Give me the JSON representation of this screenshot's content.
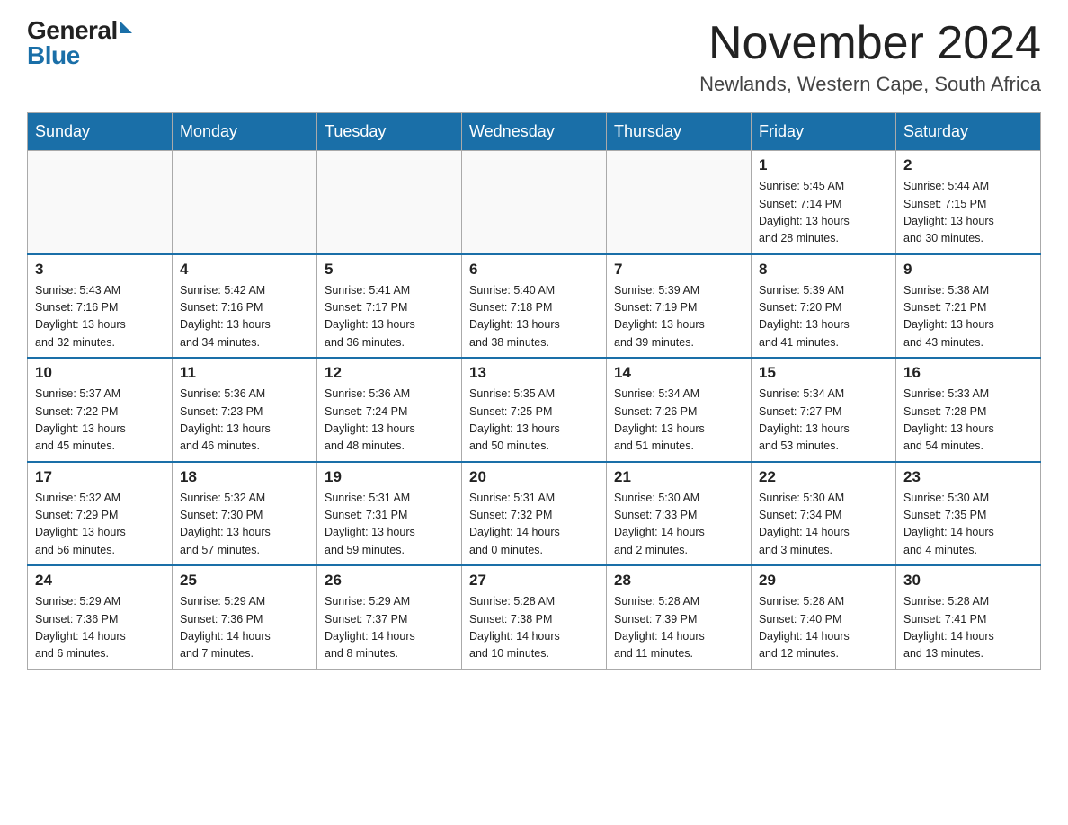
{
  "logo": {
    "general": "General",
    "blue": "Blue"
  },
  "title": "November 2024",
  "location": "Newlands, Western Cape, South Africa",
  "days_of_week": [
    "Sunday",
    "Monday",
    "Tuesday",
    "Wednesday",
    "Thursday",
    "Friday",
    "Saturday"
  ],
  "weeks": [
    [
      {
        "day": "",
        "info": ""
      },
      {
        "day": "",
        "info": ""
      },
      {
        "day": "",
        "info": ""
      },
      {
        "day": "",
        "info": ""
      },
      {
        "day": "",
        "info": ""
      },
      {
        "day": "1",
        "info": "Sunrise: 5:45 AM\nSunset: 7:14 PM\nDaylight: 13 hours\nand 28 minutes."
      },
      {
        "day": "2",
        "info": "Sunrise: 5:44 AM\nSunset: 7:15 PM\nDaylight: 13 hours\nand 30 minutes."
      }
    ],
    [
      {
        "day": "3",
        "info": "Sunrise: 5:43 AM\nSunset: 7:16 PM\nDaylight: 13 hours\nand 32 minutes."
      },
      {
        "day": "4",
        "info": "Sunrise: 5:42 AM\nSunset: 7:16 PM\nDaylight: 13 hours\nand 34 minutes."
      },
      {
        "day": "5",
        "info": "Sunrise: 5:41 AM\nSunset: 7:17 PM\nDaylight: 13 hours\nand 36 minutes."
      },
      {
        "day": "6",
        "info": "Sunrise: 5:40 AM\nSunset: 7:18 PM\nDaylight: 13 hours\nand 38 minutes."
      },
      {
        "day": "7",
        "info": "Sunrise: 5:39 AM\nSunset: 7:19 PM\nDaylight: 13 hours\nand 39 minutes."
      },
      {
        "day": "8",
        "info": "Sunrise: 5:39 AM\nSunset: 7:20 PM\nDaylight: 13 hours\nand 41 minutes."
      },
      {
        "day": "9",
        "info": "Sunrise: 5:38 AM\nSunset: 7:21 PM\nDaylight: 13 hours\nand 43 minutes."
      }
    ],
    [
      {
        "day": "10",
        "info": "Sunrise: 5:37 AM\nSunset: 7:22 PM\nDaylight: 13 hours\nand 45 minutes."
      },
      {
        "day": "11",
        "info": "Sunrise: 5:36 AM\nSunset: 7:23 PM\nDaylight: 13 hours\nand 46 minutes."
      },
      {
        "day": "12",
        "info": "Sunrise: 5:36 AM\nSunset: 7:24 PM\nDaylight: 13 hours\nand 48 minutes."
      },
      {
        "day": "13",
        "info": "Sunrise: 5:35 AM\nSunset: 7:25 PM\nDaylight: 13 hours\nand 50 minutes."
      },
      {
        "day": "14",
        "info": "Sunrise: 5:34 AM\nSunset: 7:26 PM\nDaylight: 13 hours\nand 51 minutes."
      },
      {
        "day": "15",
        "info": "Sunrise: 5:34 AM\nSunset: 7:27 PM\nDaylight: 13 hours\nand 53 minutes."
      },
      {
        "day": "16",
        "info": "Sunrise: 5:33 AM\nSunset: 7:28 PM\nDaylight: 13 hours\nand 54 minutes."
      }
    ],
    [
      {
        "day": "17",
        "info": "Sunrise: 5:32 AM\nSunset: 7:29 PM\nDaylight: 13 hours\nand 56 minutes."
      },
      {
        "day": "18",
        "info": "Sunrise: 5:32 AM\nSunset: 7:30 PM\nDaylight: 13 hours\nand 57 minutes."
      },
      {
        "day": "19",
        "info": "Sunrise: 5:31 AM\nSunset: 7:31 PM\nDaylight: 13 hours\nand 59 minutes."
      },
      {
        "day": "20",
        "info": "Sunrise: 5:31 AM\nSunset: 7:32 PM\nDaylight: 14 hours\nand 0 minutes."
      },
      {
        "day": "21",
        "info": "Sunrise: 5:30 AM\nSunset: 7:33 PM\nDaylight: 14 hours\nand 2 minutes."
      },
      {
        "day": "22",
        "info": "Sunrise: 5:30 AM\nSunset: 7:34 PM\nDaylight: 14 hours\nand 3 minutes."
      },
      {
        "day": "23",
        "info": "Sunrise: 5:30 AM\nSunset: 7:35 PM\nDaylight: 14 hours\nand 4 minutes."
      }
    ],
    [
      {
        "day": "24",
        "info": "Sunrise: 5:29 AM\nSunset: 7:36 PM\nDaylight: 14 hours\nand 6 minutes."
      },
      {
        "day": "25",
        "info": "Sunrise: 5:29 AM\nSunset: 7:36 PM\nDaylight: 14 hours\nand 7 minutes."
      },
      {
        "day": "26",
        "info": "Sunrise: 5:29 AM\nSunset: 7:37 PM\nDaylight: 14 hours\nand 8 minutes."
      },
      {
        "day": "27",
        "info": "Sunrise: 5:28 AM\nSunset: 7:38 PM\nDaylight: 14 hours\nand 10 minutes."
      },
      {
        "day": "28",
        "info": "Sunrise: 5:28 AM\nSunset: 7:39 PM\nDaylight: 14 hours\nand 11 minutes."
      },
      {
        "day": "29",
        "info": "Sunrise: 5:28 AM\nSunset: 7:40 PM\nDaylight: 14 hours\nand 12 minutes."
      },
      {
        "day": "30",
        "info": "Sunrise: 5:28 AM\nSunset: 7:41 PM\nDaylight: 14 hours\nand 13 minutes."
      }
    ]
  ]
}
